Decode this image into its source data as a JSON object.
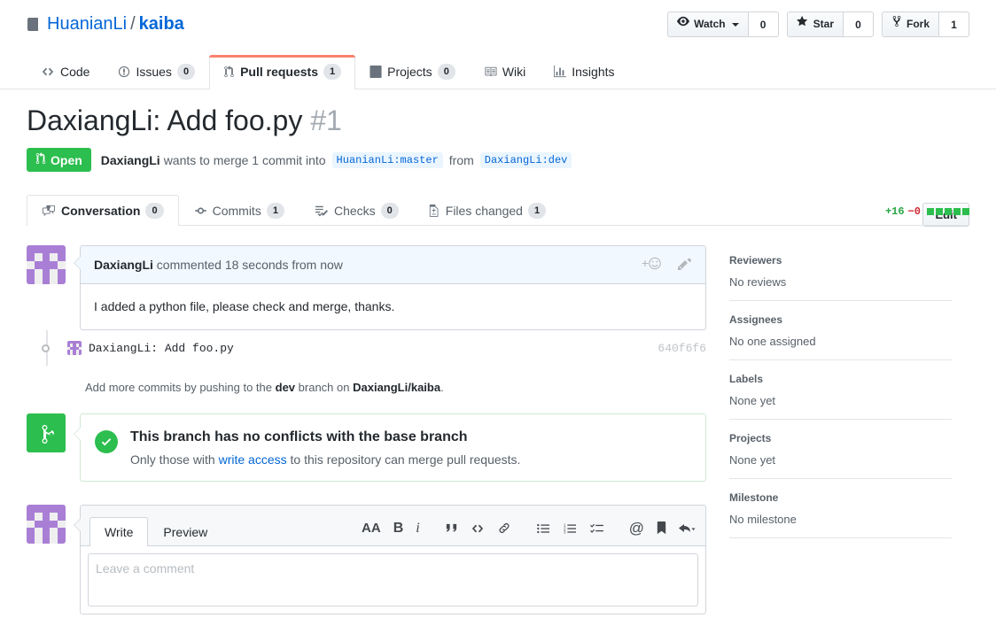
{
  "repo": {
    "owner": "HuanianLi",
    "separator": "/",
    "name": "kaiba",
    "icon": "repo-icon"
  },
  "social": [
    {
      "label": "Watch",
      "count": "0",
      "icon": "eye-icon",
      "has_caret": true
    },
    {
      "label": "Star",
      "count": "0",
      "icon": "star-icon",
      "has_caret": false
    },
    {
      "label": "Fork",
      "count": "1",
      "icon": "fork-icon",
      "has_caret": false
    }
  ],
  "repo_nav": [
    {
      "label": "Code",
      "count": null,
      "icon": "code-icon",
      "selected": false
    },
    {
      "label": "Issues",
      "count": "0",
      "icon": "issue-opened-icon",
      "selected": false
    },
    {
      "label": "Pull requests",
      "count": "1",
      "icon": "git-pull-request-icon",
      "selected": true
    },
    {
      "label": "Projects",
      "count": "0",
      "icon": "project-icon",
      "selected": false
    },
    {
      "label": "Wiki",
      "count": null,
      "icon": "book-icon",
      "selected": false
    },
    {
      "label": "Insights",
      "count": null,
      "icon": "graph-icon",
      "selected": false
    }
  ],
  "pull_request": {
    "title": "DaxiangLi: Add foo.py",
    "number": "#1",
    "edit_label": "Edit",
    "state": "Open",
    "state_color": "#2cbe4e",
    "author": "DaxiangLi",
    "meta_text_1": "wants to merge 1 commit into",
    "base_branch": "HuanianLi:master",
    "meta_text_2": "from",
    "head_branch": "DaxiangLi:dev"
  },
  "pr_tabs": [
    {
      "label": "Conversation",
      "count": "0",
      "icon": "comment-discussion-icon",
      "selected": true
    },
    {
      "label": "Commits",
      "count": "1",
      "icon": "git-commit-icon",
      "selected": false
    },
    {
      "label": "Checks",
      "count": "0",
      "icon": "checklist-icon",
      "selected": false
    },
    {
      "label": "Files changed",
      "count": "1",
      "icon": "diff-icon",
      "selected": false
    }
  ],
  "diffstat": {
    "additions": "+16",
    "deletions": "−0",
    "blocks": 5,
    "block_color": "#2cbe4e"
  },
  "comment": {
    "author": "DaxiangLi",
    "timestamp": "commented 18 seconds from now",
    "body": "I added a python file, please check and merge, thanks.",
    "reaction_icon": "add-reaction-icon",
    "edit_icon": "pencil-icon"
  },
  "commit": {
    "message": "DaxiangLi: Add foo.py",
    "sha": "640f6f6"
  },
  "push_note": {
    "prefix": "Add more commits by pushing to the",
    "branch": "dev",
    "middle": "branch on",
    "repo": "DaxiangLi/kaiba",
    "suffix": "."
  },
  "merge_status": {
    "icon": "git-merge-icon",
    "check_icon": "check-icon",
    "title": "This branch has no conflicts with the base branch",
    "sub_prefix": "Only those with",
    "sub_link": "write access",
    "sub_suffix": "to this repository can merge pull requests."
  },
  "comment_form": {
    "tabs": [
      {
        "label": "Write",
        "selected": true
      },
      {
        "label": "Preview",
        "selected": false
      }
    ],
    "placeholder": "Leave a comment",
    "toolbar": [
      {
        "group": 1,
        "icon": "heading-icon",
        "glyph": "AA"
      },
      {
        "group": 1,
        "icon": "bold-icon",
        "glyph": "B"
      },
      {
        "group": 1,
        "icon": "italic-icon",
        "glyph": "i"
      },
      {
        "group": 2,
        "icon": "quote-icon",
        "glyph": "“"
      },
      {
        "group": 2,
        "icon": "code-icon",
        "glyph": "<>"
      },
      {
        "group": 2,
        "icon": "link-icon",
        "glyph": "link"
      },
      {
        "group": 3,
        "icon": "bulleted-list-icon",
        "glyph": "ul"
      },
      {
        "group": 3,
        "icon": "numbered-list-icon",
        "glyph": "ol"
      },
      {
        "group": 3,
        "icon": "task-list-icon",
        "glyph": "task"
      },
      {
        "group": 4,
        "icon": "mention-icon",
        "glyph": "@"
      },
      {
        "group": 4,
        "icon": "saved-reply-icon",
        "glyph": "bookmark"
      },
      {
        "group": 4,
        "icon": "reply-icon",
        "glyph": "reply"
      }
    ]
  },
  "sidebar": [
    {
      "title": "Reviewers",
      "value": "No reviews"
    },
    {
      "title": "Assignees",
      "value": "No one assigned"
    },
    {
      "title": "Labels",
      "value": "None yet"
    },
    {
      "title": "Projects",
      "value": "None yet"
    },
    {
      "title": "Milestone",
      "value": "No milestone"
    }
  ],
  "identicon": {
    "color": "#a97fd6",
    "grid": [
      [
        1,
        1,
        1,
        1,
        1
      ],
      [
        1,
        0,
        1,
        0,
        1
      ],
      [
        0,
        1,
        1,
        1,
        0
      ],
      [
        1,
        0,
        1,
        0,
        1
      ],
      [
        1,
        0,
        1,
        0,
        1
      ]
    ]
  }
}
